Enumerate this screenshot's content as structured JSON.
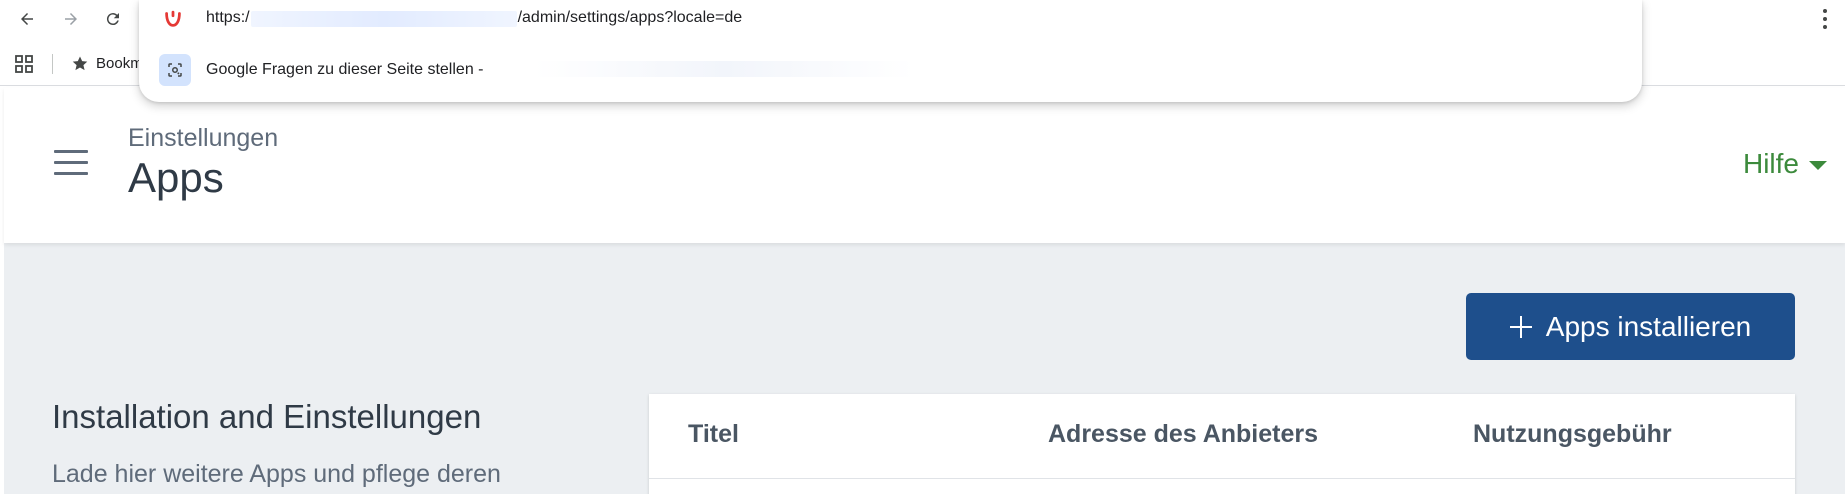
{
  "browser": {
    "url_prefix": "https:/",
    "url_suffix": "/admin/settings/apps?locale=de",
    "suggestion_text": "Google Fragen zu dieser Seite stellen -",
    "bookmarks_label": "Bookm"
  },
  "header": {
    "breadcrumb": "Einstellungen",
    "title": "Apps",
    "help_label": "Hilfe"
  },
  "main": {
    "install_button_label": "Apps installieren",
    "section_title": "Installation and Einstellungen",
    "section_description": "Lade hier weitere Apps und pflege deren",
    "table_columns": [
      "Titel",
      "Adresse des Anbieters",
      "Nutzungsgebühr"
    ]
  },
  "colors": {
    "primary": "#1e4f8c",
    "help_green": "#3c8a3c",
    "content_background": "#eceff2"
  },
  "icons": [
    "back-arrow-icon",
    "forward-arrow-icon",
    "reload-icon",
    "apps-grid-icon",
    "star-icon",
    "kebab-menu-icon",
    "site-logo-icon",
    "lens-icon",
    "hamburger-menu-icon",
    "caret-down-icon",
    "plus-icon"
  ]
}
